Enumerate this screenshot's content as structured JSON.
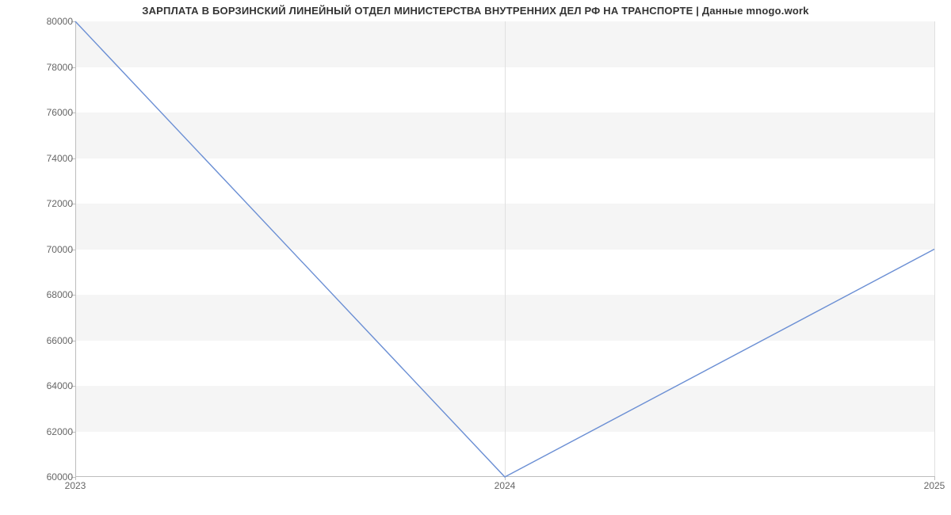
{
  "chart_data": {
    "type": "line",
    "title": "ЗАРПЛАТА В БОРЗИНСКИЙ ЛИНЕЙНЫЙ ОТДЕЛ МИНИСТЕРСТВА ВНУТРЕННИХ  ДЕЛ РФ НА ТРАНСПОРТЕ | Данные mnogo.work",
    "x": [
      2023,
      2024,
      2025
    ],
    "values": [
      80000,
      60000,
      70000
    ],
    "xlabel": "",
    "ylabel": "",
    "xlim": [
      2023,
      2025
    ],
    "ylim": [
      60000,
      80000
    ],
    "y_ticks": [
      60000,
      62000,
      64000,
      66000,
      68000,
      70000,
      72000,
      74000,
      76000,
      78000,
      80000
    ],
    "x_ticks": [
      2023,
      2024,
      2025
    ],
    "x_tick_labels": [
      "2023",
      "2024",
      "2025"
    ],
    "y_tick_labels": [
      "60000",
      "62000",
      "64000",
      "66000",
      "68000",
      "70000",
      "72000",
      "74000",
      "76000",
      "78000",
      "80000"
    ],
    "line_color": "#6b8fd4",
    "grid_alt_bands": true
  }
}
